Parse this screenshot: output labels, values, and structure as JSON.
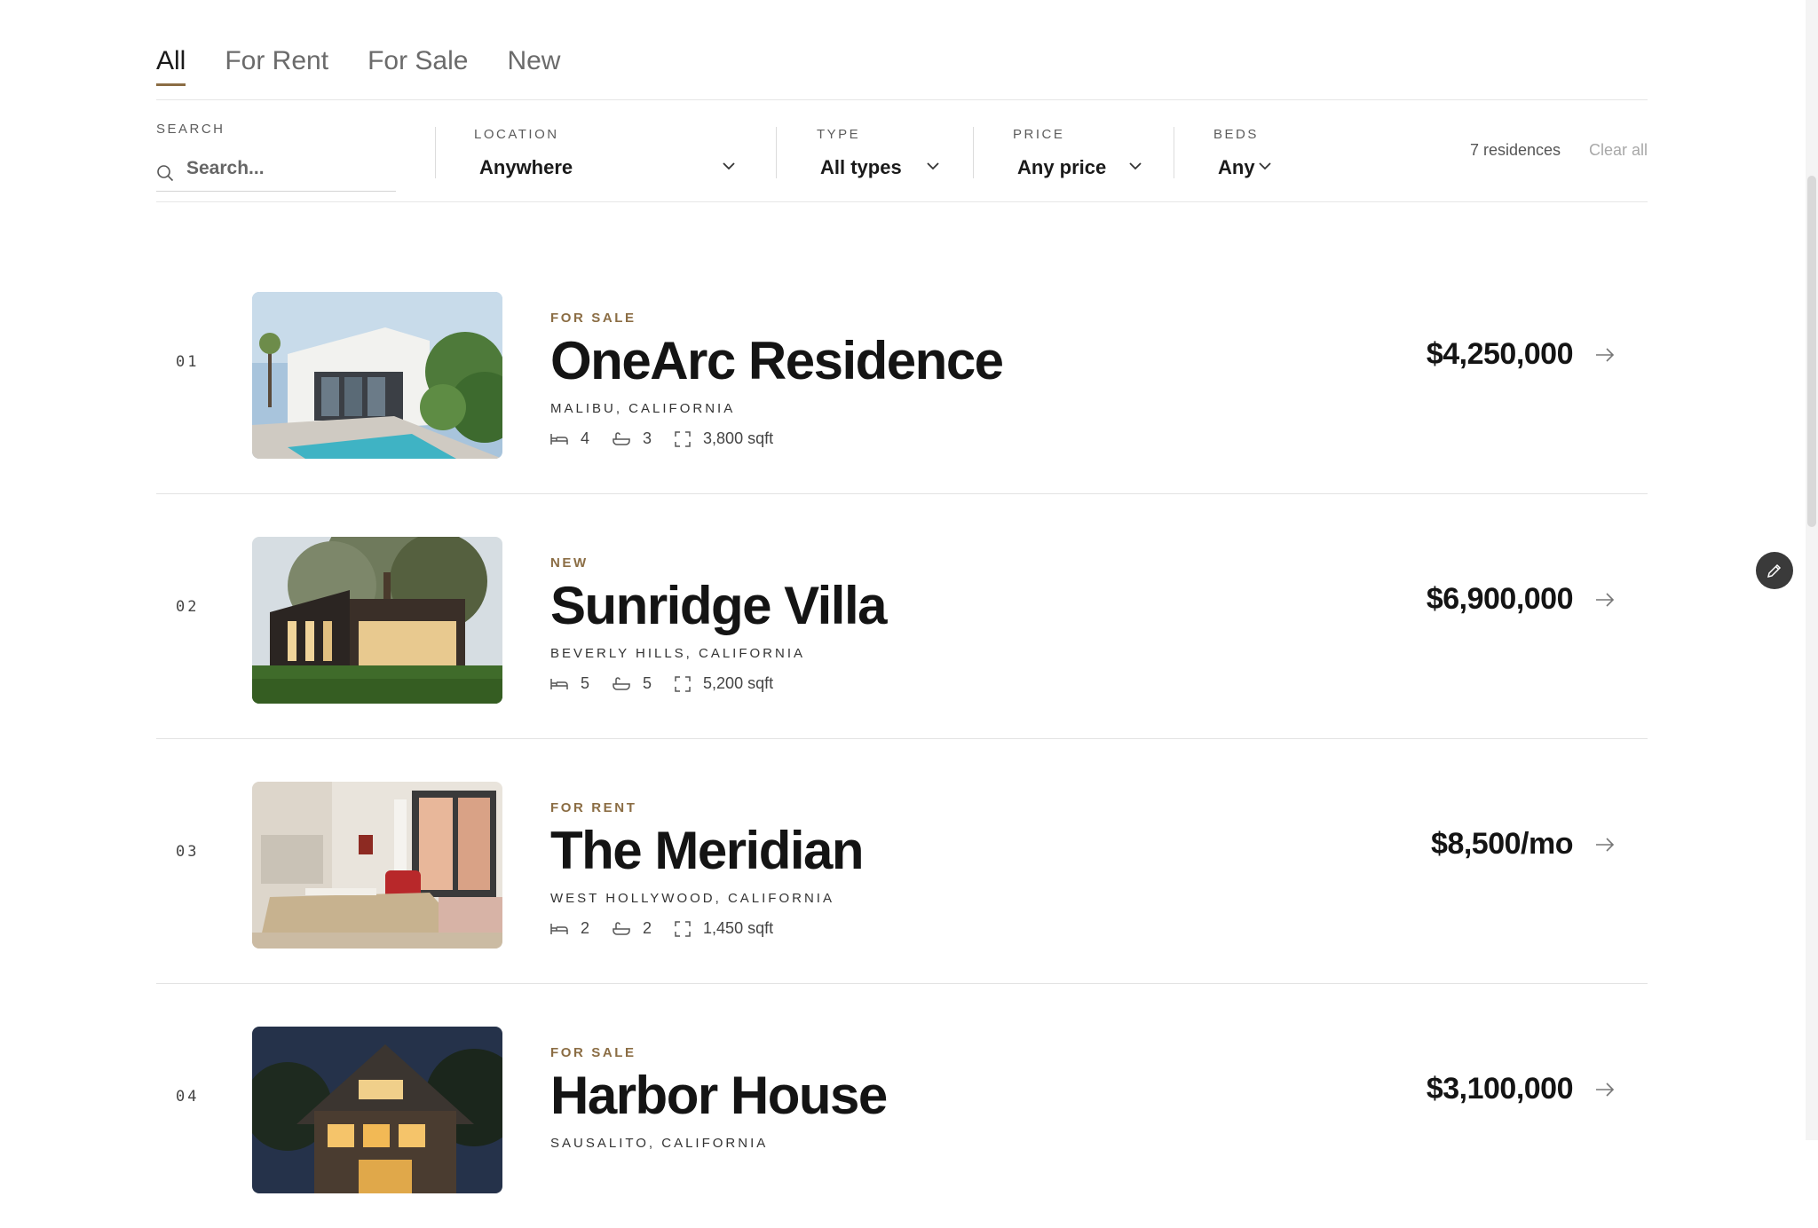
{
  "tabs": [
    {
      "label": "All",
      "active": true
    },
    {
      "label": "For Rent",
      "active": false
    },
    {
      "label": "For Sale",
      "active": false
    },
    {
      "label": "New",
      "active": false
    }
  ],
  "filters": {
    "search": {
      "label": "SEARCH",
      "placeholder": "Search...",
      "value": ""
    },
    "location": {
      "label": "LOCATION",
      "value": "Anywhere"
    },
    "type": {
      "label": "TYPE",
      "value": "All types"
    },
    "price": {
      "label": "PRICE",
      "value": "Any price"
    },
    "beds": {
      "label": "BEDS",
      "value": "Any"
    },
    "result_count": "7 residences",
    "clear_label": "Clear all"
  },
  "listings": [
    {
      "number": "01",
      "status": "FOR SALE",
      "title": "OneArc Residence",
      "location": "MALIBU, CALIFORNIA",
      "beds": "4",
      "baths": "3",
      "area": "3,800 sqft",
      "price": "$4,250,000"
    },
    {
      "number": "02",
      "status": "NEW",
      "title": "Sunridge Villa",
      "location": "BEVERLY HILLS, CALIFORNIA",
      "beds": "5",
      "baths": "5",
      "area": "5,200 sqft",
      "price": "$6,900,000"
    },
    {
      "number": "03",
      "status": "FOR RENT",
      "title": "The Meridian",
      "location": "WEST HOLLYWOOD, CALIFORNIA",
      "beds": "2",
      "baths": "2",
      "area": "1,450 sqft",
      "price": "$8,500/mo"
    },
    {
      "number": "04",
      "status": "FOR SALE",
      "title": "Harbor House",
      "location": "SAUSALITO, CALIFORNIA",
      "beds": "",
      "baths": "",
      "area": "",
      "price": "$3,100,000"
    }
  ],
  "colors": {
    "accent": "#8b6d44",
    "text": "#141414",
    "muted": "#a8a8a8"
  },
  "icons": {
    "bed": "bed-icon",
    "bath": "bath-icon",
    "area": "area-icon",
    "arrow": "arrow-right-icon",
    "search": "search-icon",
    "chevron": "chevron-down-icon",
    "edit": "pencil-icon"
  }
}
